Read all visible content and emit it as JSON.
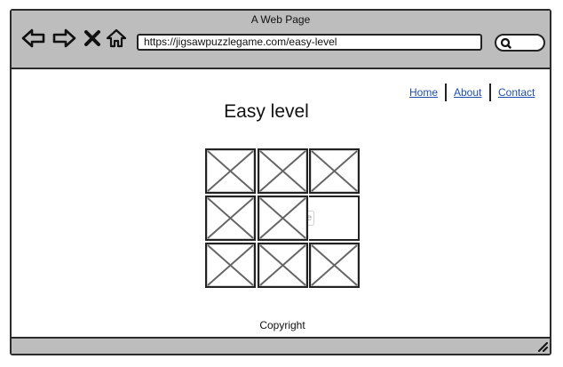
{
  "window": {
    "title": "A Web Page"
  },
  "toolbar": {
    "buttons": [
      "back-arrow-icon",
      "forward-arrow-icon",
      "close-x-icon",
      "home-icon"
    ],
    "url": "https://jigsawpuzzlegame.com/easy-level",
    "search_icon": "search-icon"
  },
  "nav": {
    "links": [
      "Home",
      "About",
      "Contact"
    ]
  },
  "page": {
    "heading": "Easy level",
    "grid_rows": 3,
    "grid_cols": 3,
    "empty_tile": {
      "row": 2,
      "col": 3
    },
    "hidden_text": "e",
    "footer": "Copyright"
  },
  "colors": {
    "chrome": "#bdbdbd",
    "link": "#1f4fb3",
    "border": "#2b2b2b"
  }
}
